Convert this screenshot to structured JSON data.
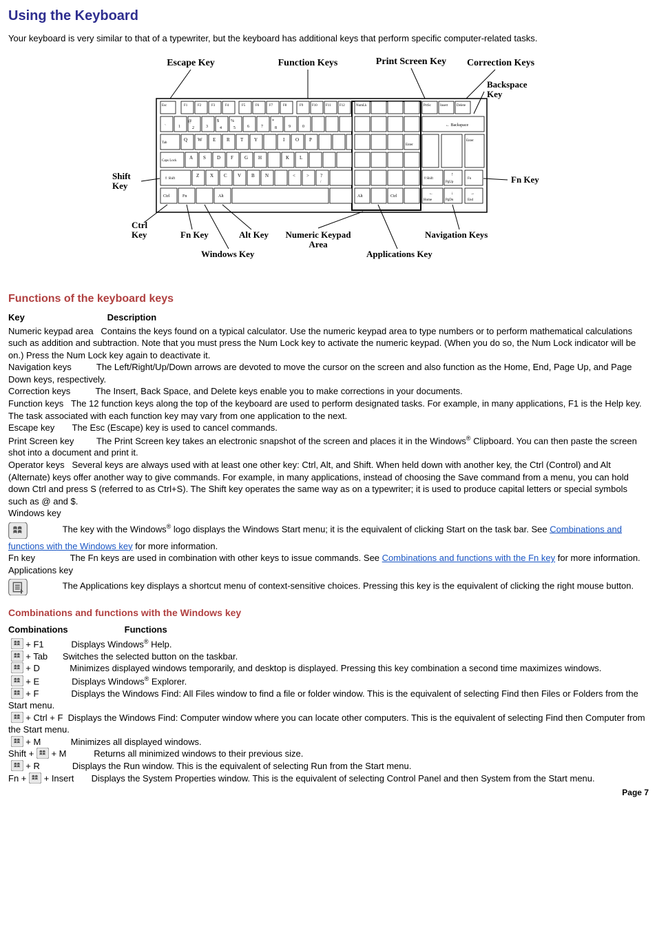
{
  "title": "Using the Keyboard",
  "intro": "Your keyboard is very similar to that of a typewriter, but the keyboard has additional keys that perform specific computer-related tasks.",
  "diagram_labels": {
    "escape": "Escape Key",
    "function": "Function Keys",
    "printscreen": "Print Screen Key",
    "correction": "Correction Keys",
    "backspace": "Backspace Key",
    "shift": "Shift Key",
    "ctrl": "Ctrl Key",
    "fn": "Fn Key",
    "windows": "Windows Key",
    "alt": "Alt Key",
    "numeric": "Numeric Keypad Area",
    "applications": "Applications Key",
    "navigation": "Navigation Keys",
    "fnkey_right": "Fn Key"
  },
  "section_functions": "Functions of the keyboard keys",
  "tbl": {
    "key_h": "Key",
    "desc_h": "Description"
  },
  "rows": {
    "numeric_key": "Numeric keypad area",
    "numeric_desc": "Contains the keys found on a typical calculator. Use the numeric keypad area to type numbers or to perform mathematical calculations such as addition and subtraction. Note that you must press the Num Lock key to activate the numeric keypad. (When you do so, the Num Lock indicator will be on.) Press the Num Lock key again to deactivate it.",
    "nav_key": "Navigation keys",
    "nav_desc": "The Left/Right/Up/Down arrows are devoted to move the cursor on the screen and also function as the Home, End, Page Up, and Page Down keys, respectively.",
    "corr_key": "Correction keys",
    "corr_desc": "The Insert, Back Space, and Delete keys enable you to make corrections in your documents.",
    "func_key": "Function keys",
    "func_desc": "The 12 function keys along the top of the keyboard are used to perform designated tasks. For example, in many applications, F1 is the Help key. The task associated with each function key may vary from one application to the next.",
    "esc_key": "Escape key",
    "esc_desc": "The Esc (Escape) key is used to cancel commands.",
    "ps_key": "Print Screen key",
    "ps_desc_a": "The Print Screen key takes an electronic snapshot of the screen and places it in the Windows",
    "ps_desc_b": " Clipboard. You can then paste the screen shot into a document and print it.",
    "op_key": "Operator keys",
    "op_desc": "Several keys are always used with at least one other key: Ctrl, Alt, and Shift. When held down with another key, the Ctrl (Control) and Alt (Alternate) keys offer another way to give commands. For example, in many applications, instead of choosing the Save command from a menu, you can hold down Ctrl and press S (referred to as Ctrl+S). The Shift key operates the same way as on a typewriter; it is used to produce capital letters or special symbols such as @ and $.",
    "win_key": "Windows key",
    "win_desc_a": "The key with the Windows",
    "win_desc_b": " logo displays the Windows Start menu; it is the equivalent of clicking Start on the task bar. See ",
    "win_link": "Combinations and functions with the Windows key",
    "win_desc_c": " for more information.",
    "fn_key": "Fn key",
    "fn_desc_a": "The Fn keys are used in combination with other keys to issue commands. See ",
    "fn_link": "Combinations and functions with the Fn key",
    "fn_desc_b": " for more information.",
    "app_key": "Applications key",
    "app_desc": "The Applications key displays a shortcut menu of context-sensitive choices. Pressing this key is the equivalent of clicking the right mouse button."
  },
  "section_combo": "Combinations and functions with the Windows key",
  "combo_head": {
    "c": "Combinations",
    "f": "Functions"
  },
  "combos": {
    "f1_c": " + F1",
    "f1_f_a": "Displays Windows",
    "f1_f_b": " Help.",
    "tab_c": " + Tab",
    "tab_f": "Switches the selected button on the taskbar.",
    "d_c": " + D",
    "d_f": "Minimizes displayed windows temporarily, and desktop is displayed. Pressing this key combination a second time maximizes windows.",
    "e_c": " + E",
    "e_f_a": "Displays Windows",
    "e_f_b": " Explorer.",
    "f_c": " + F",
    "f_f": "Displays the Windows Find: All Files window to find a file or folder window. This is the equivalent of selecting Find then Files or Folders from the Start menu.",
    "cf_c": " + Ctrl + F",
    "cf_f": "Displays the Windows Find: Computer window where you can locate other computers. This is the equivalent of selecting Find then Computer from the Start menu.",
    "m_c": " + M",
    "m_f": "Minimizes all displayed windows.",
    "sm_c_a": "Shift + ",
    "sm_c_b": " + M",
    "sm_f": "Returns all minimized windows to their previous size.",
    "r_c": " + R",
    "r_f": "Displays the Run window. This is the equivalent of selecting Run from the Start menu.",
    "ins_c_a": "Fn + ",
    "ins_c_b": " + Insert",
    "ins_f": "Displays the System Properties window. This is the equivalent of selecting Control Panel and then System from the Start menu."
  },
  "page": "Page 7",
  "reg": "®"
}
